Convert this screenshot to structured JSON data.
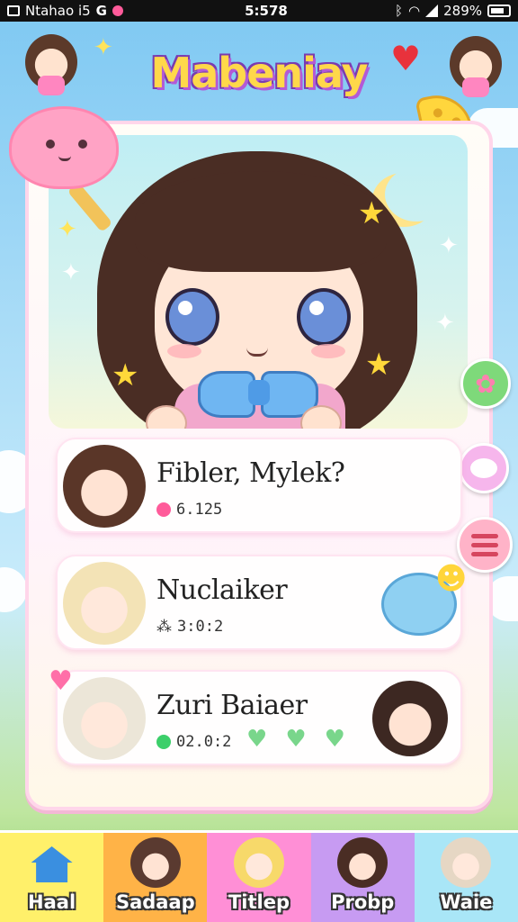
{
  "status_bar": {
    "left_text": "Ntahao i5",
    "g_label": "G",
    "time": "5:578",
    "battery": "289%"
  },
  "header": {
    "app_title": "Mabeniay"
  },
  "list": [
    {
      "title": "Fibler, Mylek?",
      "meta": "6.125",
      "meta_icon": "flower-icon",
      "meta_color": "#ff5b9a"
    },
    {
      "title": "Nuclaiker",
      "meta": "3:0:2",
      "meta_icon": "paw-icon",
      "meta_color": "#555555"
    },
    {
      "title": "Zuri Baiaer",
      "meta": "02.0:2",
      "meta_icon": "leaf-icon",
      "meta_color": "#3ccf6a"
    }
  ],
  "bottom_nav": [
    {
      "label": "Haal",
      "color": "#fff06a",
      "icon": "house-icon"
    },
    {
      "label": "Sadaap",
      "color": "#ffb347",
      "icon": "cat-icon"
    },
    {
      "label": "Titlep",
      "color": "#ff8fd6",
      "icon": "girl-icon"
    },
    {
      "label": "Probp",
      "color": "#c79bf2",
      "icon": "catgirl-icon"
    },
    {
      "label": "Waie",
      "color": "#a9e6f7",
      "icon": "bunny-icon"
    }
  ],
  "colors": {
    "accent_pink": "#ff86b0",
    "title_yellow": "#ffd84a",
    "title_purple": "#b35ad6"
  }
}
